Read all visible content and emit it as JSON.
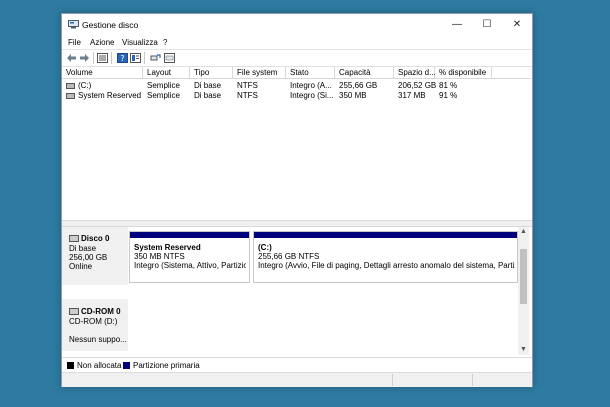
{
  "window": {
    "title": "Gestione disco"
  },
  "menu": [
    "File",
    "Azione",
    "Visualizza",
    "?"
  ],
  "volume_table": {
    "columns": [
      "Volume",
      "Layout",
      "Tipo",
      "File system",
      "Stato",
      "Capacità",
      "Spazio d...",
      "% disponibile"
    ],
    "rows": [
      [
        "(C:)",
        "Semplice",
        "Di base",
        "NTFS",
        "Integro (A...",
        "255,66 GB",
        "206,52 GB",
        "81 %"
      ],
      [
        "System Reserved",
        "Semplice",
        "Di base",
        "NTFS",
        "Integro (Si...",
        "350 MB",
        "317 MB",
        "91 %"
      ]
    ]
  },
  "disks": [
    {
      "title": "Disco 0",
      "lines": [
        "Di base",
        "256,00 GB",
        "Online"
      ],
      "partitions": [
        {
          "name": "System Reserved",
          "size": "350 MB NTFS",
          "status": "Integro (Sistema, Attivo, Partizione primaria)"
        },
        {
          "name": "(C:)",
          "size": "255,66 GB NTFS",
          "status": "Integro (Avvio, File di paging, Dettagli arresto anomalo del sistema, Partizione primaria)"
        }
      ]
    },
    {
      "title": "CD-ROM 0",
      "lines": [
        "CD-ROM (D:)",
        "",
        "Nessun suppo..."
      ]
    }
  ],
  "legend": [
    {
      "label": "Non allocata",
      "color": "#000000"
    },
    {
      "label": "Partizione primaria",
      "color": "#00007b"
    }
  ],
  "icons": {
    "app": "disk-management-icon",
    "toolbar": [
      "back-arrow-icon",
      "forward-arrow-icon",
      "list-view-icon",
      "help-icon",
      "properties-icon",
      "rescan-icon",
      "settings-icon"
    ]
  }
}
